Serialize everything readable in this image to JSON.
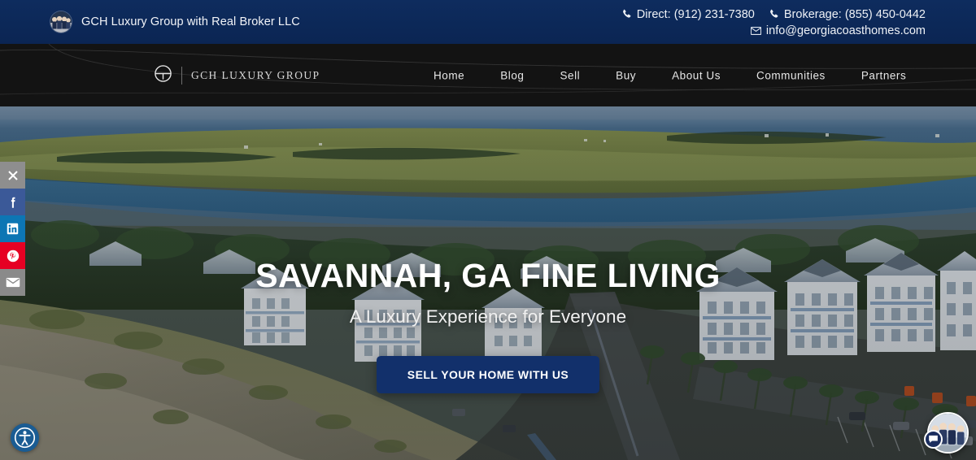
{
  "topbar": {
    "brand_name": "GCH Luxury Group with Real Broker LLC",
    "avatar_alt": "team-photo",
    "direct_label": "Direct: (912) 231-7380",
    "brokerage_label": "Brokerage: (855) 450-0442",
    "email_label": "info@georgiacoasthomes.com",
    "background_color": "#0b2553",
    "text_color": "#eef1f6"
  },
  "nav": {
    "logo_text": "GCH LUXURY GROUP",
    "background_color": "#131313",
    "items": [
      {
        "label": "Home"
      },
      {
        "label": "Blog"
      },
      {
        "label": "Sell"
      },
      {
        "label": "Buy"
      },
      {
        "label": "About Us"
      },
      {
        "label": "Communities"
      },
      {
        "label": "Partners"
      }
    ]
  },
  "hero": {
    "title": "SAVANNAH, GA FINE LIVING",
    "subtitle": "A Luxury Experience for Everyone",
    "cta_label": "SELL YOUR HOME WITH US",
    "cta_color": "#12306b",
    "scene": "aerial coastal beachfront homes with marsh and ocean"
  },
  "social_rail": {
    "items": [
      {
        "name": "close",
        "color": "#8e8e8e"
      },
      {
        "name": "facebook",
        "color": "#3b5998"
      },
      {
        "name": "linkedin",
        "color": "#0d76b4"
      },
      {
        "name": "pinterest",
        "color": "#e60023"
      },
      {
        "name": "email",
        "color": "#8a8a8a"
      }
    ]
  },
  "accessibility": {
    "color": "#1a5c93",
    "label": "accessibility-options"
  },
  "chat": {
    "badge_color": "#1b2d5e",
    "label": "live-chat"
  }
}
